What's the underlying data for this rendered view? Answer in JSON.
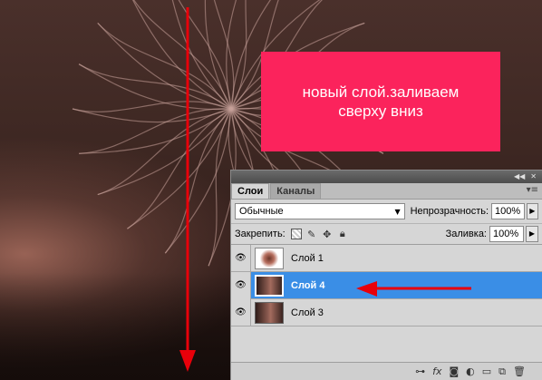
{
  "note": {
    "line1": "новый слой.заливаем",
    "line2": "сверху вниз",
    "color": "#fb235c"
  },
  "panel": {
    "titlebar_icons": [
      "collapse-icon",
      "close-icon"
    ],
    "tabs": [
      {
        "label": "Слои",
        "active": true
      },
      {
        "label": "Каналы",
        "active": false
      }
    ],
    "blend_mode": "Обычные",
    "opacity_label": "Непрозрачность:",
    "opacity_value": "100%",
    "lock_label": "Закрепить:",
    "fill_label": "Заливка:",
    "fill_value": "100%",
    "layers": [
      {
        "name": "Слой 1",
        "selected": false,
        "visible": true
      },
      {
        "name": "Слой 4",
        "selected": true,
        "visible": true
      },
      {
        "name": "Слой 3",
        "selected": false,
        "visible": true
      }
    ],
    "footer_icons": [
      "link-icon",
      "fx-icon",
      "mask-icon",
      "adjustment-icon",
      "folder-icon",
      "new-layer-icon",
      "trash-icon"
    ]
  },
  "annotation_color": "#e8000a"
}
